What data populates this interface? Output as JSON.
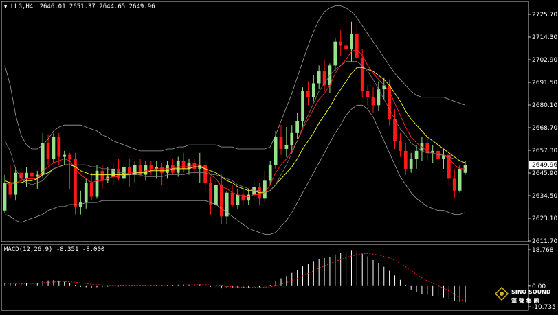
{
  "header": {
    "symbol": "LLG,H4",
    "ohlc": "2646.01 2651.37 2644.65 2649.96"
  },
  "price_axis": {
    "labels": [
      "2725.70",
      "2714.30",
      "2702.90",
      "2691.50",
      "2680.10",
      "2668.70",
      "2657.30",
      "2645.90",
      "2634.50",
      "2623.10",
      "2611.70"
    ],
    "current": "2649.96"
  },
  "macd": {
    "title": "MACD(12,26,9) -8.351 -8.000",
    "axis_labels": [
      "18.768",
      "0.00",
      "-10.735"
    ]
  },
  "logo": {
    "line1": "SINO SOUND",
    "line2": "漢 聲 集 團"
  },
  "colors": {
    "bull": "#98e08c",
    "bear": "#ff1a1a",
    "ma_fast": "#ff2020",
    "ma_slow": "#f0f030",
    "band": "#a0a0a0",
    "macd_bar": "#ffffff",
    "macd_signal": "#ff2020"
  },
  "chart_data": {
    "type": "candlestick",
    "symbol": "LLG",
    "timeframe": "H4",
    "ylim": [
      2609.0,
      2731.0
    ],
    "candles": [
      [
        2627,
        2645,
        2626,
        2641
      ],
      [
        2641,
        2650,
        2633,
        2635
      ],
      [
        2635,
        2649,
        2632,
        2646
      ],
      [
        2646,
        2649,
        2641,
        2643
      ],
      [
        2643,
        2649,
        2639,
        2646
      ],
      [
        2646,
        2649,
        2642,
        2644
      ],
      [
        2644,
        2647,
        2638,
        2645
      ],
      [
        2645,
        2666,
        2643,
        2661
      ],
      [
        2661,
        2665,
        2650,
        2653
      ],
      [
        2653,
        2666,
        2651,
        2664
      ],
      [
        2664,
        2666,
        2650,
        2654
      ],
      [
        2654,
        2657,
        2650,
        2655
      ],
      [
        2655,
        2656,
        2638,
        2653
      ],
      [
        2653,
        2656,
        2625,
        2629
      ],
      [
        2629,
        2637,
        2625,
        2631
      ],
      [
        2631,
        2643,
        2628,
        2641
      ],
      [
        2641,
        2646,
        2632,
        2634
      ],
      [
        2634,
        2650,
        2633,
        2647
      ],
      [
        2647,
        2650,
        2638,
        2642
      ],
      [
        2642,
        2649,
        2641,
        2644
      ],
      [
        2644,
        2651,
        2640,
        2648
      ],
      [
        2648,
        2653,
        2642,
        2643
      ],
      [
        2643,
        2651,
        2641,
        2649
      ],
      [
        2649,
        2653,
        2639,
        2645
      ],
      [
        2645,
        2652,
        2641,
        2650
      ],
      [
        2650,
        2653,
        2644,
        2645
      ],
      [
        2645,
        2652,
        2642,
        2650
      ],
      [
        2650,
        2652,
        2645,
        2648
      ],
      [
        2648,
        2652,
        2643,
        2649
      ],
      [
        2649,
        2651,
        2640,
        2646
      ],
      [
        2646,
        2652,
        2643,
        2650
      ],
      [
        2650,
        2653,
        2645,
        2646
      ],
      [
        2646,
        2654,
        2644,
        2652
      ],
      [
        2652,
        2656,
        2646,
        2648
      ],
      [
        2648,
        2653,
        2645,
        2651
      ],
      [
        2651,
        2653,
        2646,
        2648
      ],
      [
        2648,
        2656,
        2641,
        2650
      ],
      [
        2650,
        2652,
        2637,
        2641
      ],
      [
        2641,
        2644,
        2625,
        2630
      ],
      [
        2630,
        2642,
        2629,
        2640
      ],
      [
        2640,
        2645,
        2620,
        2624
      ],
      [
        2624,
        2637,
        2620,
        2636
      ],
      [
        2636,
        2640,
        2629,
        2630
      ],
      [
        2630,
        2638,
        2628,
        2635
      ],
      [
        2635,
        2638,
        2630,
        2632
      ],
      [
        2632,
        2638,
        2630,
        2635
      ],
      [
        2635,
        2642,
        2632,
        2639
      ],
      [
        2639,
        2641,
        2630,
        2633
      ],
      [
        2633,
        2647,
        2631,
        2642
      ],
      [
        2642,
        2652,
        2640,
        2650
      ],
      [
        2650,
        2667,
        2648,
        2664
      ],
      [
        2664,
        2670,
        2655,
        2658
      ],
      [
        2658,
        2669,
        2654,
        2660
      ],
      [
        2660,
        2670,
        2656,
        2666
      ],
      [
        2666,
        2676,
        2663,
        2672
      ],
      [
        2672,
        2689,
        2669,
        2687
      ],
      [
        2687,
        2692,
        2680,
        2684
      ],
      [
        2684,
        2695,
        2682,
        2691
      ],
      [
        2691,
        2700,
        2688,
        2697
      ],
      [
        2697,
        2703,
        2687,
        2690
      ],
      [
        2690,
        2701,
        2686,
        2700
      ],
      [
        2700,
        2714,
        2697,
        2712
      ],
      [
        2712,
        2718,
        2705,
        2710
      ],
      [
        2710,
        2725,
        2703,
        2708
      ],
      [
        2708,
        2722,
        2702,
        2716
      ],
      [
        2716,
        2720,
        2702,
        2704
      ],
      [
        2704,
        2708,
        2684,
        2687
      ],
      [
        2687,
        2690,
        2680,
        2684
      ],
      [
        2684,
        2689,
        2676,
        2680
      ],
      [
        2680,
        2692,
        2677,
        2688
      ],
      [
        2688,
        2694,
        2683,
        2690
      ],
      [
        2690,
        2693,
        2670,
        2673
      ],
      [
        2673,
        2678,
        2658,
        2662
      ],
      [
        2662,
        2666,
        2654,
        2657
      ],
      [
        2657,
        2661,
        2645,
        2648
      ],
      [
        2648,
        2656,
        2646,
        2653
      ],
      [
        2653,
        2660,
        2648,
        2657
      ],
      [
        2657,
        2664,
        2652,
        2661
      ],
      [
        2661,
        2663,
        2652,
        2656
      ],
      [
        2656,
        2660,
        2651,
        2657
      ],
      [
        2657,
        2659,
        2649,
        2653
      ],
      [
        2653,
        2658,
        2648,
        2655
      ],
      [
        2655,
        2657,
        2640,
        2643
      ],
      [
        2643,
        2648,
        2633,
        2637
      ],
      [
        2637,
        2650,
        2636,
        2648
      ],
      [
        2646,
        2652,
        2645,
        2650
      ]
    ],
    "series": [
      {
        "name": "",
        "color": "#ff2020",
        "values": [
          2641,
          2640,
          2641,
          2642,
          2643,
          2643,
          2643,
          2647,
          2649,
          2651,
          2652,
          2653,
          2652,
          2648,
          2645,
          2643,
          2641,
          2642,
          2642,
          2643,
          2644,
          2644,
          2645,
          2646,
          2646,
          2646,
          2647,
          2647,
          2648,
          2648,
          2648,
          2648,
          2649,
          2649,
          2649,
          2650,
          2650,
          2648,
          2645,
          2643,
          2639,
          2638,
          2636,
          2635,
          2634,
          2634,
          2635,
          2635,
          2636,
          2640,
          2646,
          2650,
          2653,
          2657,
          2662,
          2668,
          2673,
          2678,
          2683,
          2686,
          2690,
          2696,
          2700,
          2703,
          2707,
          2708,
          2705,
          2700,
          2696,
          2693,
          2690,
          2687,
          2681,
          2675,
          2669,
          2664,
          2661,
          2659,
          2657,
          2656,
          2655,
          2655,
          2653,
          2650,
          2648,
          2648
        ]
      },
      {
        "name": "",
        "color": "#f0f030",
        "values": [
          2642,
          2641,
          2641,
          2641,
          2642,
          2642,
          2643,
          2645,
          2646,
          2648,
          2649,
          2650,
          2650,
          2649,
          2647,
          2646,
          2645,
          2645,
          2645,
          2645,
          2645,
          2645,
          2645,
          2645,
          2646,
          2646,
          2646,
          2647,
          2647,
          2647,
          2647,
          2648,
          2648,
          2648,
          2648,
          2649,
          2649,
          2648,
          2647,
          2646,
          2644,
          2642,
          2641,
          2639,
          2638,
          2637,
          2637,
          2636,
          2636,
          2637,
          2640,
          2643,
          2646,
          2649,
          2653,
          2658,
          2662,
          2666,
          2671,
          2675,
          2679,
          2684,
          2688,
          2692,
          2696,
          2699,
          2699,
          2698,
          2697,
          2695,
          2693,
          2690,
          2686,
          2682,
          2677,
          2673,
          2670,
          2667,
          2664,
          2662,
          2660,
          2658,
          2656,
          2654,
          2652,
          2651
        ]
      },
      {
        "name": "",
        "color": "#a0a0a0",
        "values": [
          2700,
          2690,
          2675,
          2665,
          2660,
          2658,
          2658,
          2660,
          2663,
          2667,
          2669,
          2670,
          2670,
          2670,
          2670,
          2669,
          2668,
          2667,
          2665,
          2664,
          2662,
          2661,
          2660,
          2659,
          2658,
          2657,
          2657,
          2657,
          2657,
          2657,
          2658,
          2658,
          2659,
          2659,
          2660,
          2660,
          2660,
          2660,
          2660,
          2660,
          2659,
          2659,
          2659,
          2658,
          2658,
          2658,
          2658,
          2658,
          2658,
          2659,
          2665,
          2672,
          2679,
          2686,
          2694,
          2702,
          2710,
          2717,
          2723,
          2727,
          2729,
          2730,
          2730,
          2729,
          2727,
          2724,
          2720,
          2716,
          2712,
          2708,
          2704,
          2700,
          2696,
          2693,
          2690,
          2687,
          2685,
          2684,
          2684,
          2684,
          2684,
          2684,
          2683,
          2682,
          2681,
          2680
        ]
      },
      {
        "name": "",
        "color": "#a0a0a0",
        "values": [
          2625,
          2624,
          2622,
          2621,
          2622,
          2623,
          2624,
          2625,
          2627,
          2628,
          2629,
          2629,
          2630,
          2630,
          2630,
          2631,
          2631,
          2631,
          2632,
          2632,
          2632,
          2632,
          2632,
          2632,
          2632,
          2632,
          2632,
          2632,
          2632,
          2632,
          2632,
          2632,
          2632,
          2632,
          2632,
          2632,
          2632,
          2632,
          2631,
          2630,
          2628,
          2626,
          2624,
          2622,
          2620,
          2618,
          2617,
          2616,
          2615,
          2615,
          2616,
          2619,
          2622,
          2626,
          2631,
          2636,
          2641,
          2646,
          2651,
          2656,
          2661,
          2666,
          2670,
          2675,
          2678,
          2680,
          2680,
          2678,
          2674,
          2668,
          2662,
          2656,
          2650,
          2644,
          2640,
          2636,
          2633,
          2631,
          2629,
          2628,
          2627,
          2627,
          2626,
          2625,
          2625,
          2626
        ]
      },
      {
        "name": "",
        "color": "#808080",
        "values": [
          2662,
          2657,
          2648,
          2643,
          2641,
          2640,
          2641,
          2642,
          2645,
          2648,
          2649,
          2650,
          2650,
          2650,
          2650,
          2650,
          2649,
          2649,
          2648,
          2648,
          2647,
          2646,
          2646,
          2645,
          2645,
          2645,
          2644,
          2644,
          2644,
          2644,
          2645,
          2645,
          2645,
          2645,
          2646,
          2646,
          2646,
          2646,
          2645,
          2645,
          2644,
          2643,
          2642,
          2640,
          2639,
          2638,
          2637,
          2637,
          2636,
          2637,
          2640,
          2645,
          2650,
          2656,
          2662,
          2669,
          2675,
          2681,
          2687,
          2691,
          2695,
          2698,
          2700,
          2702,
          2702,
          2702,
          2700,
          2697,
          2693,
          2688,
          2683,
          2678,
          2673,
          2668,
          2665,
          2661,
          2659,
          2657,
          2656,
          2656,
          2655,
          2655,
          2654,
          2653,
          2653,
          2653
        ]
      }
    ],
    "macd": {
      "params": "12,26,9",
      "ylim": [
        -10.735,
        18.768
      ],
      "histogram": [
        1.5,
        1.2,
        1.1,
        1.3,
        1.4,
        1.5,
        1.6,
        2.4,
        2.9,
        3.1,
        2.8,
        2.2,
        1.7,
        0.5,
        -0.4,
        -0.6,
        -0.8,
        -0.6,
        -0.5,
        -0.3,
        -0.2,
        -0.2,
        0.0,
        0.1,
        0.2,
        0.2,
        0.3,
        0.4,
        0.5,
        0.5,
        0.6,
        0.6,
        0.7,
        0.8,
        0.8,
        0.8,
        0.9,
        0.5,
        -0.3,
        -0.6,
        -1.2,
        -1.0,
        -1.1,
        -1.0,
        -1.0,
        -0.8,
        -0.6,
        -0.6,
        -0.3,
        0.6,
        2.5,
        4.0,
        5.2,
        6.8,
        8.4,
        10.2,
        11.3,
        12.6,
        13.9,
        14.5,
        15.2,
        16.4,
        17.1,
        17.8,
        18.3,
        18.0,
        16.8,
        15.4,
        13.5,
        12.0,
        10.0,
        7.9,
        5.5,
        3.2,
        0.5,
        -1.8,
        -3.0,
        -4.0,
        -4.5,
        -5.2,
        -5.5,
        -6.0,
        -6.5,
        -7.6,
        -8.2,
        -8.351
      ],
      "signal": [
        1.4,
        1.4,
        1.3,
        1.3,
        1.3,
        1.4,
        1.4,
        1.6,
        1.9,
        2.1,
        2.3,
        2.3,
        2.2,
        2.0,
        1.6,
        1.3,
        0.9,
        0.7,
        0.5,
        0.3,
        0.2,
        0.1,
        0.1,
        0.1,
        0.1,
        0.1,
        0.2,
        0.2,
        0.3,
        0.3,
        0.4,
        0.4,
        0.5,
        0.5,
        0.6,
        0.6,
        0.7,
        0.7,
        0.5,
        0.3,
        0.1,
        -0.2,
        -0.4,
        -0.5,
        -0.6,
        -0.7,
        -0.7,
        -0.7,
        -0.6,
        -0.4,
        0.1,
        0.9,
        1.8,
        2.9,
        4.0,
        5.3,
        6.6,
        7.9,
        9.2,
        10.4,
        11.5,
        12.7,
        13.7,
        14.7,
        15.6,
        16.3,
        16.7,
        16.8,
        16.5,
        16.1,
        15.4,
        14.5,
        13.3,
        11.8,
        10.0,
        8.0,
        6.0,
        4.2,
        2.7,
        1.4,
        0.2,
        -1.1,
        -2.6,
        -4.2,
        -6.3,
        -8.0
      ]
    }
  }
}
